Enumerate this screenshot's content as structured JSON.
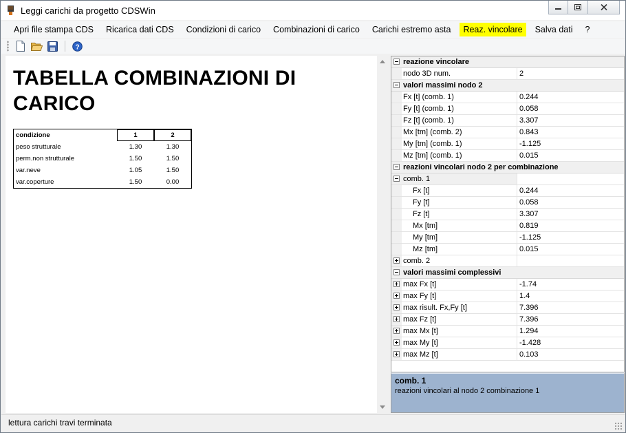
{
  "window": {
    "title": "Leggi carichi da progetto CDSWin"
  },
  "menu": {
    "items": [
      {
        "label": "Apri file stampa CDS",
        "active": false
      },
      {
        "label": "Ricarica dati CDS",
        "active": false
      },
      {
        "label": "Condizioni di carico",
        "active": false
      },
      {
        "label": "Combinazioni di carico",
        "active": false
      },
      {
        "label": "Carichi estremo asta",
        "active": false
      },
      {
        "label": "Reaz. vincolare",
        "active": true
      },
      {
        "label": "Salva dati",
        "active": false
      },
      {
        "label": "?",
        "active": false
      }
    ],
    "active_highlight_color": "#ffff00"
  },
  "toolbar": {
    "icons": [
      "new-file-icon",
      "open-folder-icon",
      "save-disk-icon",
      "help-icon"
    ]
  },
  "document": {
    "title": "TABELLA COMBINAZIONI DI CARICO",
    "table": {
      "header_label": "condizione",
      "columns": [
        "1",
        "2"
      ],
      "rows": [
        {
          "label": "peso strutturale",
          "values": [
            "1.30",
            "1.30"
          ]
        },
        {
          "label": "perm.non strutturale",
          "values": [
            "1.50",
            "1.50"
          ]
        },
        {
          "label": "var.neve",
          "values": [
            "1.05",
            "1.50"
          ]
        },
        {
          "label": "var.coperture",
          "values": [
            "1.50",
            "0.00"
          ]
        }
      ]
    }
  },
  "property_grid": {
    "sections": [
      {
        "title": "reazione vincolare",
        "rows": [
          {
            "name": "nodo 3D num.",
            "value": "2"
          }
        ]
      },
      {
        "title": "valori massimi nodo 2",
        "rows": [
          {
            "name": "Fx   [t]       (comb. 1)",
            "value": "0.244"
          },
          {
            "name": "Fy   [t]       (comb. 1)",
            "value": "0.058"
          },
          {
            "name": "Fz   [t]       (comb. 1)",
            "value": "3.307"
          },
          {
            "name": "Mx   [tm]      (comb. 2)",
            "value": "0.843"
          },
          {
            "name": "My   [tm]      (comb. 1)",
            "value": "-1.125"
          },
          {
            "name": "Mz   [tm]      (comb. 1)",
            "value": "0.015"
          }
        ]
      },
      {
        "title": "reazioni vincolari nodo 2 per combinazione",
        "groups": [
          {
            "label": "comb. 1",
            "expanded": true,
            "rows": [
              {
                "name": "Fx  [t]",
                "value": "0.244"
              },
              {
                "name": "Fy  [t]",
                "value": "0.058"
              },
              {
                "name": "Fz  [t]",
                "value": "3.307"
              },
              {
                "name": "Mx  [tm]",
                "value": "0.819"
              },
              {
                "name": "My  [tm]",
                "value": "-1.125"
              },
              {
                "name": "Mz  [tm]",
                "value": "0.015"
              }
            ]
          },
          {
            "label": "comb. 2",
            "expanded": false,
            "rows": []
          }
        ]
      },
      {
        "title": "valori massimi complessivi",
        "rows": [
          {
            "name": "max Fx [t]",
            "value": "-1.74"
          },
          {
            "name": "max Fy [t]",
            "value": "1.4"
          },
          {
            "name": "max risult. Fx,Fy [t]",
            "value": "7.396"
          },
          {
            "name": "max Fz [t]",
            "value": "7.396"
          },
          {
            "name": "max Mx [t]",
            "value": "1.294"
          },
          {
            "name": "max My [t]",
            "value": "-1.428"
          },
          {
            "name": "max Mz [t]",
            "value": "0.103"
          }
        ]
      }
    ]
  },
  "description": {
    "title": "comb. 1",
    "text": "reazioni vincolari al nodo 2 combinazione 1"
  },
  "status": {
    "text": "lettura carichi travi terminata"
  }
}
